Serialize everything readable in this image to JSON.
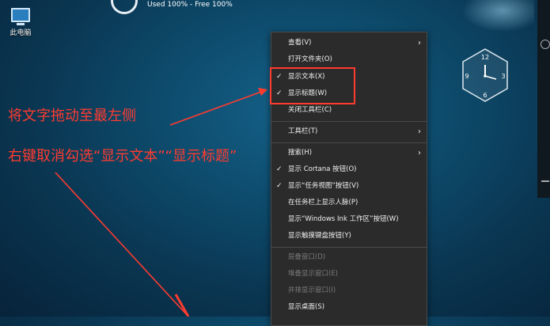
{
  "desktop": {
    "pc_icon_label": "此电脑",
    "disk_status": "Used 100%   -   Free 100%"
  },
  "clock": {
    "n12": "12",
    "n3": "3",
    "n6": "6",
    "n9": "9"
  },
  "annotations": {
    "note1": "将文字拖动至最左侧",
    "note2": "右键取消勾选“显示文本”“显示标题”"
  },
  "menu": {
    "items": [
      {
        "label": "查看(V)",
        "checked": false,
        "submenu": true,
        "disabled": false
      },
      {
        "label": "打开文件夹(O)",
        "checked": false,
        "submenu": false,
        "disabled": false
      },
      {
        "label": "显示文本(X)",
        "checked": true,
        "submenu": false,
        "disabled": false
      },
      {
        "label": "显示标题(W)",
        "checked": true,
        "submenu": false,
        "disabled": false
      },
      {
        "label": "关闭工具栏(C)",
        "checked": false,
        "submenu": false,
        "disabled": false
      },
      {
        "label": "工具栏(T)",
        "checked": false,
        "submenu": true,
        "disabled": false
      },
      {
        "label": "搜索(H)",
        "checked": false,
        "submenu": true,
        "disabled": false
      },
      {
        "label": "显示 Cortana 按钮(O)",
        "checked": true,
        "submenu": false,
        "disabled": false
      },
      {
        "label": "显示“任务视图”按钮(V)",
        "checked": true,
        "submenu": false,
        "disabled": false
      },
      {
        "label": "在任务栏上显示人脉(P)",
        "checked": false,
        "submenu": false,
        "disabled": false
      },
      {
        "label": "显示“Windows Ink 工作区”按钮(W)",
        "checked": false,
        "submenu": false,
        "disabled": false
      },
      {
        "label": "显示触摸键盘按钮(Y)",
        "checked": false,
        "submenu": false,
        "disabled": false
      },
      {
        "label": "层叠窗口(D)",
        "checked": false,
        "submenu": false,
        "disabled": true
      },
      {
        "label": "堆叠显示窗口(E)",
        "checked": false,
        "submenu": false,
        "disabled": true
      },
      {
        "label": "并排显示窗口(I)",
        "checked": false,
        "submenu": false,
        "disabled": true
      },
      {
        "label": "显示桌面(S)",
        "checked": false,
        "submenu": false,
        "disabled": false
      }
    ],
    "check_glyph": "✓",
    "arrow_glyph": "›"
  },
  "colors": {
    "annotation": "#ff3b30",
    "menu_bg": "#2b2b2b"
  }
}
